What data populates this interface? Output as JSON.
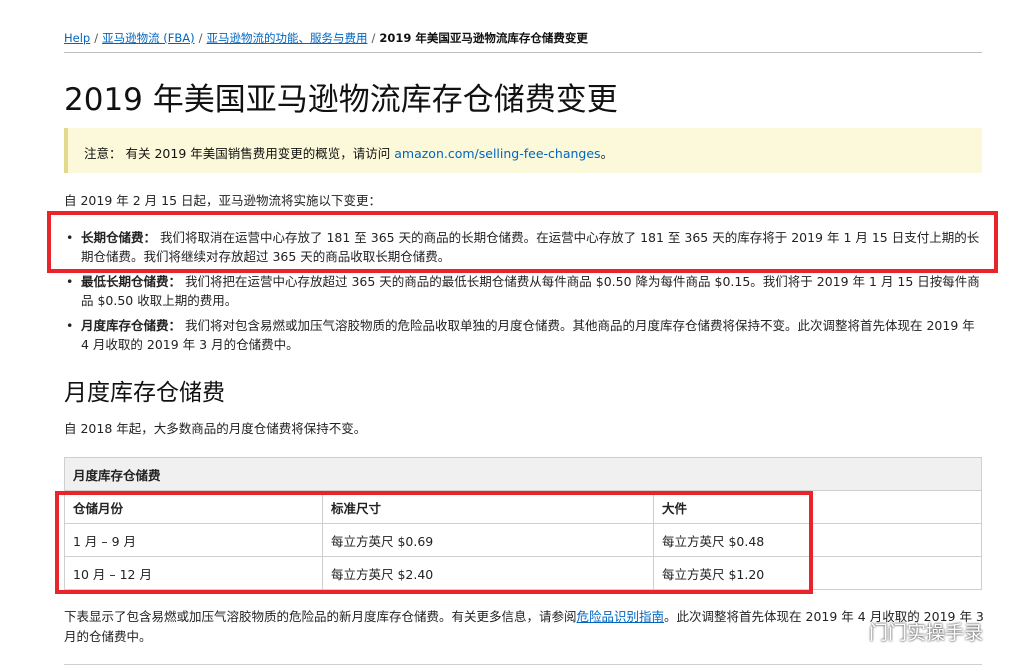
{
  "breadcrumb": {
    "items": [
      "Help",
      "亚马逊物流 (FBA)",
      "亚马逊物流的功能、服务与费用"
    ],
    "current": "2019 年美国亚马逊物流库存仓储费变更"
  },
  "page_title": "2019 年美国亚马逊物流库存仓储费变更",
  "note": {
    "label": "注意：",
    "text": "有关 2019 年美国销售费用变更的概览，请访问",
    "link": "amazon.com/selling-fee-changes",
    "end": "。"
  },
  "intro": "自 2019 年 2 月 15 日起，亚马逊物流将实施以下变更：",
  "bullets": [
    {
      "label": "长期仓储费：",
      "text": "我们将取消在运营中心存放了 181 至 365 天的商品的长期仓储费。在运营中心存放了 181 至 365 天的库存将于 2019 年 1 月 15 日支付上期的长期仓储费。我们将继续对存放超过 365 天的商品收取长期仓储费。"
    },
    {
      "label": "最低长期仓储费：",
      "text": "我们将把在运营中心存放超过 365 天的商品的最低长期仓储费从每件商品 $0.50 降为每件商品 $0.15。我们将于 2019 年 1 月 15 日按每件商品 $0.50 收取上期的费用。"
    },
    {
      "label": "月度库存仓储费：",
      "text": "我们将对包含易燃或加压气溶胶物质的危险品收取单独的月度仓储费。其他商品的月度库存仓储费将保持不变。此次调整将首先体现在 2019 年 4 月收取的 2019 年 3 月的仓储费中。"
    }
  ],
  "section": {
    "heading": "月度库存仓储费",
    "subtext": "自 2018 年起，大多数商品的月度仓储费将保持不变。"
  },
  "table": {
    "caption": "月度库存仓储费",
    "headers": [
      "仓储月份",
      "标准尺寸",
      "大件"
    ],
    "rows": [
      [
        "1 月 – 9 月",
        "每立方英尺 $0.69",
        "每立方英尺 $0.48"
      ],
      [
        "10 月 – 12 月",
        "每立方英尺 $2.40",
        "每立方英尺 $1.20"
      ]
    ]
  },
  "footer": {
    "text_before": "下表显示了包含易燃或加压气溶胶物质的危险品的新月度库存仓储费。有关更多信息，请参阅",
    "link": "危险品识别指南",
    "text_after": "。此次调整将首先体现在 2019 年 4 月收取的 2019 年 3 月的仓储费中。"
  },
  "watermark": "门门实操手录",
  "colors": {
    "link": "#0066c0",
    "highlight_box": "#e8252a",
    "note_bg": "#fbf9d9"
  }
}
